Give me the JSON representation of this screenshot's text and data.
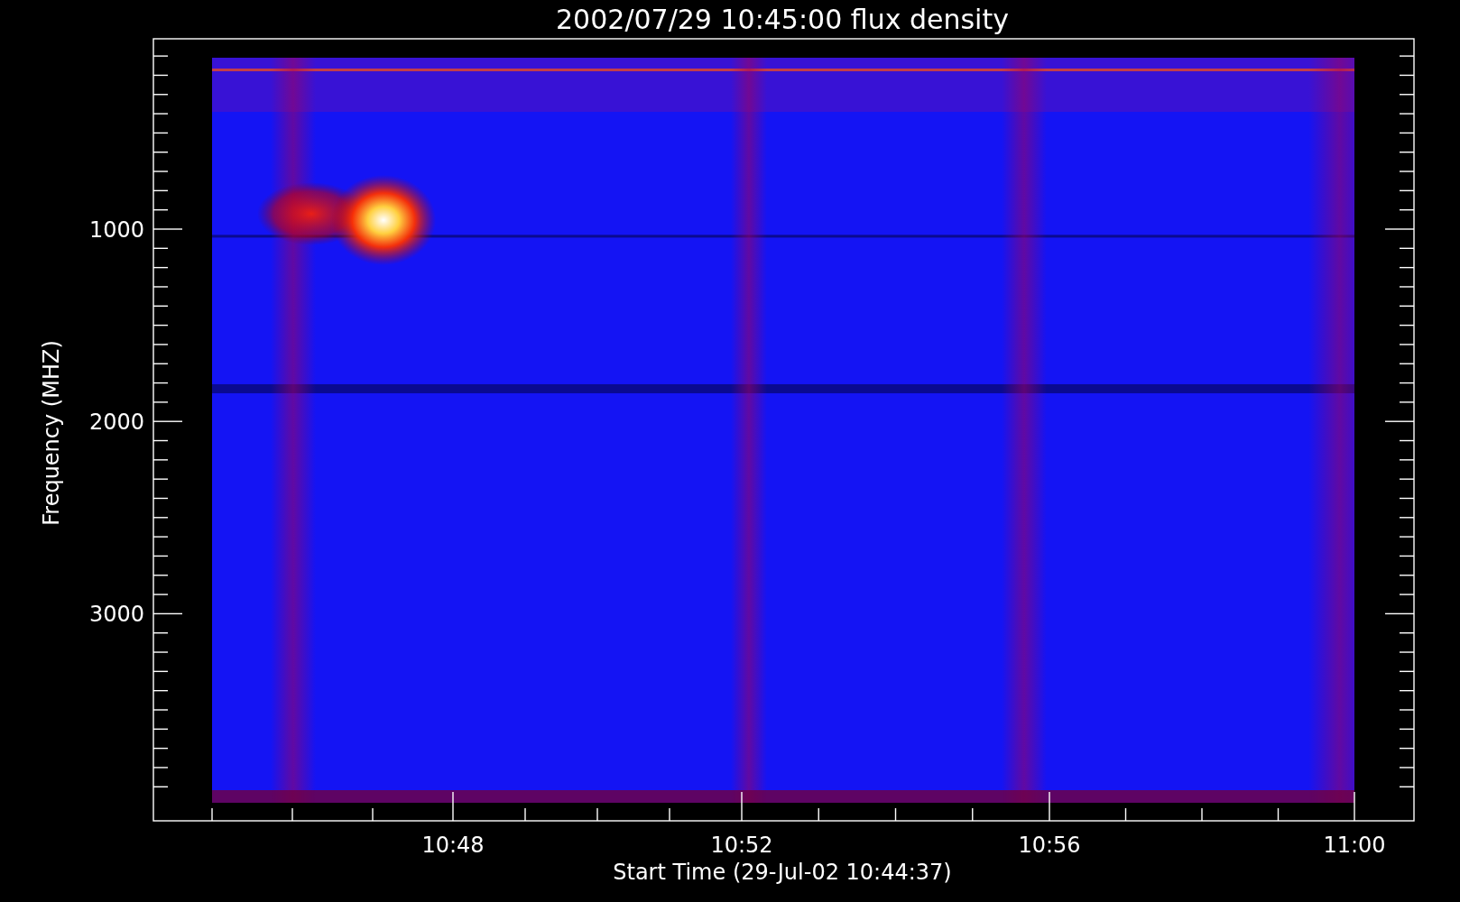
{
  "title": "2002/07/29 10:45:00 flux density",
  "y_axis": {
    "label": "Frequency (MHZ)",
    "ticks": [
      "1000",
      "2000",
      "3000"
    ]
  },
  "x_axis": {
    "label": "Start Time (29-Jul-02 10:44:37)",
    "ticks": [
      "10:48",
      "10:52",
      "10:56",
      "11:00"
    ]
  }
}
